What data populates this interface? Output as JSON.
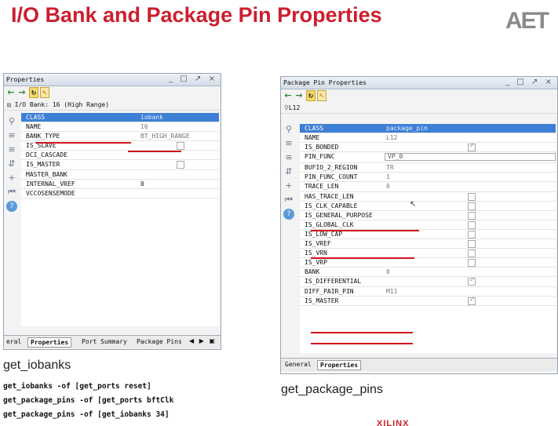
{
  "slide": {
    "title": "I/O Bank and Package Pin Properties",
    "logo": "AET",
    "footer_logo": "XILINX"
  },
  "left_panel": {
    "title": "Properties",
    "window_buttons": "_ □ ↗ ×",
    "object_label": "I/O Bank: 16 (High Range)",
    "rows": [
      {
        "name": "CLASS",
        "value": "iobank"
      },
      {
        "name": "NAME",
        "value": "16"
      },
      {
        "name": "BANK_TYPE",
        "value": "BT_HIGH_RANGE"
      },
      {
        "name": "IS_SLAVE",
        "value": ""
      },
      {
        "name": "DCI_CASCADE",
        "value": ""
      },
      {
        "name": "IS_MASTER",
        "value": ""
      },
      {
        "name": "MASTER_BANK",
        "value": ""
      },
      {
        "name": "INTERNAL_VREF",
        "value": "0"
      },
      {
        "name": "VCCOSENSEMODE",
        "value": ""
      }
    ],
    "tabs": [
      "eral",
      "Properties",
      "Port Summary",
      "Package Pins"
    ],
    "tab_nav": "◀ ▶ ▣"
  },
  "right_panel": {
    "title": "Package Pin Properties",
    "window_buttons": "_ □ ↗ ×",
    "object_label": "L12",
    "rows": [
      {
        "name": "CLASS",
        "value": "package_pin"
      },
      {
        "name": "NAME",
        "value": "L12"
      },
      {
        "name": "IS_BONDED",
        "value": ""
      },
      {
        "name": "PIN_FUNC",
        "value": "VP_0"
      },
      {
        "name": "BUFIO_2_REGION",
        "value": "TR"
      },
      {
        "name": "PIN_FUNC_COUNT",
        "value": "1"
      },
      {
        "name": "TRACE_LEN",
        "value": "0"
      },
      {
        "name": "HAS_TRACE_LEN",
        "value": ""
      },
      {
        "name": "IS_CLK_CAPABLE",
        "value": ""
      },
      {
        "name": "IS_GENERAL_PURPOSE",
        "value": ""
      },
      {
        "name": "IS_GLOBAL_CLK",
        "value": ""
      },
      {
        "name": "IS_LOW_CAP",
        "value": ""
      },
      {
        "name": "IS_VREF",
        "value": ""
      },
      {
        "name": "IS_VRN",
        "value": ""
      },
      {
        "name": "IS_VRP",
        "value": ""
      },
      {
        "name": "BANK",
        "value": "0"
      },
      {
        "name": "IS_DIFFERENTIAL",
        "value": ""
      },
      {
        "name": "DIFF_PAIR_PIN",
        "value": "M11"
      },
      {
        "name": "IS_MASTER",
        "value": ""
      }
    ],
    "tabs": [
      "General",
      "Properties"
    ]
  },
  "captions": {
    "left": "get_iobanks",
    "right": "get_package_pins"
  },
  "commands": [
    "get_iobanks -of [get_ports reset]",
    "get_package_pins -of [get_ports bftClk",
    "get_package_pins -of [get_iobanks 34]"
  ]
}
